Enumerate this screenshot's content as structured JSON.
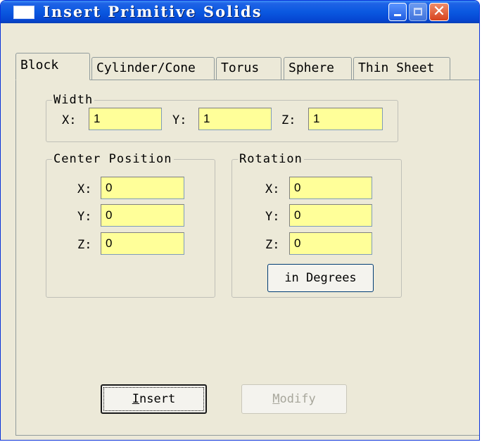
{
  "window": {
    "title": "Insert Primitive Solids",
    "icons": {
      "app": "window-icon",
      "minimize": "minimize-icon",
      "maximize": "maximize-icon",
      "close": "close-icon"
    },
    "close_glyph": "✕"
  },
  "tabs": [
    {
      "label": "Block",
      "active": true
    },
    {
      "label": "Cylinder/Cone",
      "active": false
    },
    {
      "label": "Torus",
      "active": false
    },
    {
      "label": "Sphere",
      "active": false
    },
    {
      "label": "Thin Sheet",
      "active": false
    }
  ],
  "width_group": {
    "legend": "Width",
    "x": {
      "label": "X:",
      "value": "1"
    },
    "y": {
      "label": "Y:",
      "value": "1"
    },
    "z": {
      "label": "Z:",
      "value": "1"
    }
  },
  "center_group": {
    "legend": "Center Position",
    "x": {
      "label": "X:",
      "value": "0"
    },
    "y": {
      "label": "Y:",
      "value": "0"
    },
    "z": {
      "label": "Z:",
      "value": "0"
    }
  },
  "rotation_group": {
    "legend": "Rotation",
    "x": {
      "label": "X:",
      "value": "0"
    },
    "y": {
      "label": "Y:",
      "value": "0"
    },
    "z": {
      "label": "Z:",
      "value": "0"
    },
    "degrees_button": "in Degrees"
  },
  "buttons": {
    "insert_first": "I",
    "insert_rest": "nsert",
    "modify_first": "M",
    "modify_rest": "odify",
    "modify_enabled": false
  },
  "colors": {
    "input_background": "#ffff99",
    "dialog_background": "#ece9d8",
    "titlebar": "#0a58e0",
    "close_button": "#d6421d"
  }
}
